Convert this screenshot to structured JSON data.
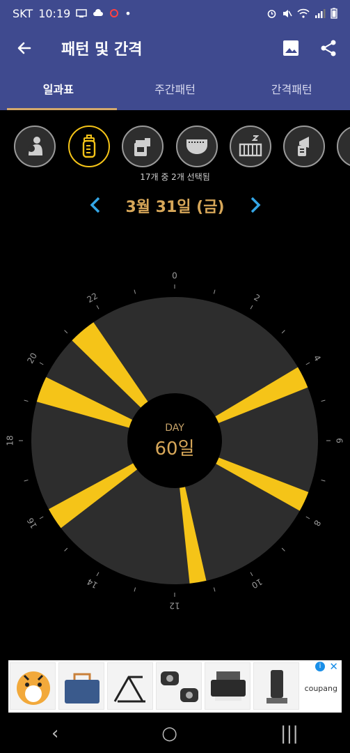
{
  "status_bar": {
    "carrier": "SKT",
    "time": "10:19",
    "dot": "•"
  },
  "app_bar": {
    "title": "패턴 및 간격"
  },
  "tabs": [
    {
      "label": "일과표"
    },
    {
      "label": "주간패턴"
    },
    {
      "label": "간격패턴"
    }
  ],
  "categories": [
    {
      "icon": "feeding-mother-icon",
      "selected": false
    },
    {
      "icon": "baby-bottle-icon",
      "selected": true
    },
    {
      "icon": "formula-jar-icon",
      "selected": false
    },
    {
      "icon": "diaper-icon",
      "selected": false
    },
    {
      "icon": "sleep-crib-icon",
      "selected": false
    },
    {
      "icon": "breast-pump-icon",
      "selected": false
    },
    {
      "icon": "more-icon",
      "selected": false
    }
  ],
  "selection_status": "17개 중 2개 선택됨",
  "date": {
    "label": "3월 31일 (금)"
  },
  "clock": {
    "center_caption": "DAY",
    "center_value": "60일",
    "hour_labels": [
      "0",
      "2",
      "4",
      "6",
      "8",
      "10",
      "12",
      "14",
      "16",
      "18",
      "20",
      "22"
    ],
    "colors": {
      "dial": "#2d2d2d",
      "event": "#f5c418",
      "center": "#000000",
      "ticks": "#9a9a9a",
      "center_caption": "#c8a46a",
      "center_value": "#d7a759"
    }
  },
  "chart_data": {
    "type": "radial-timeline",
    "period_hours": 24,
    "events": [
      {
        "start_hour": 20.95,
        "end_hour": 21.7
      },
      {
        "start_hour": 19.05,
        "end_hour": 19.75
      },
      {
        "start_hour": 3.95,
        "end_hour": 4.55
      },
      {
        "start_hour": 7.4,
        "end_hour": 7.95
      },
      {
        "start_hour": 11.15,
        "end_hour": 11.6
      },
      {
        "start_hour": 15.5,
        "end_hour": 16.1
      }
    ]
  },
  "ad": {
    "brand": "coupang",
    "info": "i",
    "close": "✕"
  },
  "nav": {
    "back": "‹",
    "home": "○",
    "recents": "|||"
  }
}
